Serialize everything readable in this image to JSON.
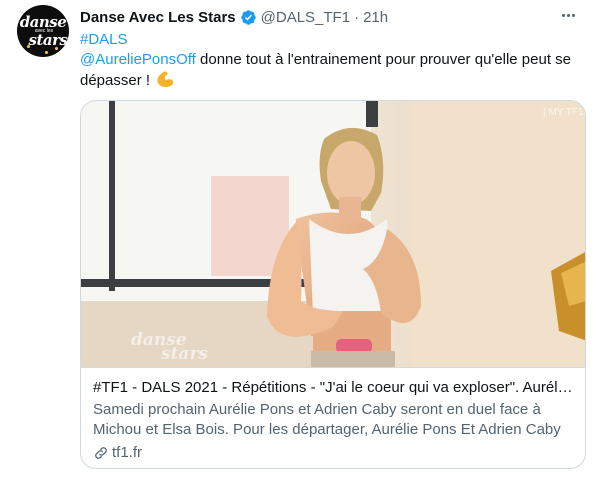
{
  "tweet": {
    "author_name": "Danse Avec Les Stars",
    "handle": "@DALS_TF1",
    "separator": "·",
    "time": "21h",
    "hashtag": "#DALS",
    "mention": "@AureliePonsOff",
    "body_text": " donne tout à l'entrainement pour prouver qu'elle peut se dépasser ! ",
    "emoji": "flexed-biceps"
  },
  "avatar": {
    "logo_line1": "danse",
    "logo_small": "avec les",
    "logo_line2": "stars"
  },
  "card": {
    "watermark_logo": "danse avec les stars",
    "corner_watermark": "MY TF1",
    "title": "#TF1 - DALS 2021 - Répétitions - \"J'ai le coeur qui va exploser\". Auréli...",
    "description": "Samedi prochain Aurélie Pons et Adrien Caby seront en duel face à Michou et Elsa Bois. Pour les départager, Aurélie Pons Et Adrien Caby ...",
    "domain": "tf1.fr"
  },
  "colors": {
    "link": "#1d9bf0",
    "secondary_text": "#536471",
    "border": "#cfd9de",
    "verified": "#1d9bf0"
  }
}
